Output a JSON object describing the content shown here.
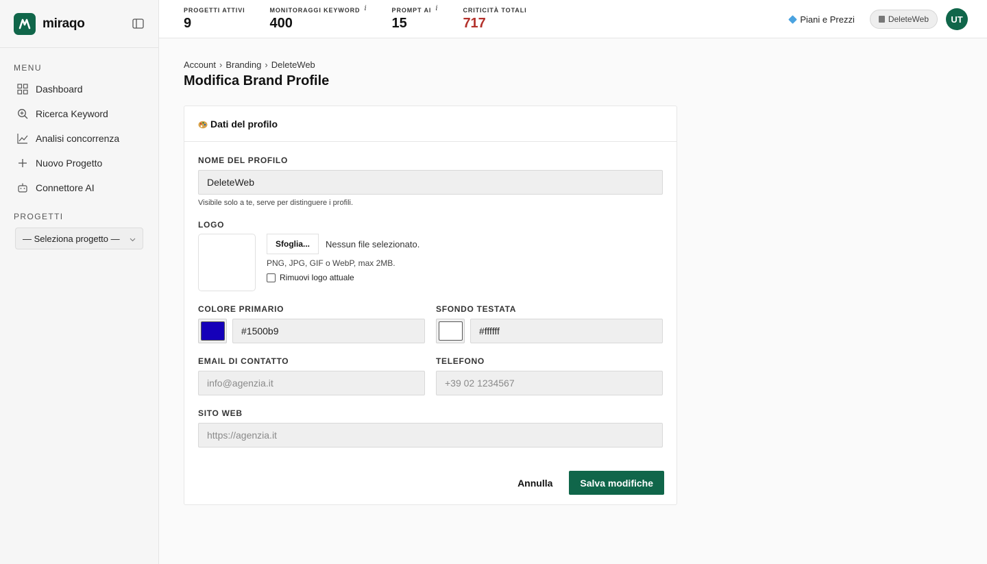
{
  "app": {
    "name": "miraqo",
    "accent": "#10664a"
  },
  "sidebar": {
    "menu_label": "MENU",
    "items": [
      {
        "label": "Dashboard",
        "icon": "grid-icon"
      },
      {
        "label": "Ricerca Keyword",
        "icon": "search-icon"
      },
      {
        "label": "Analisi concorrenza",
        "icon": "chart-line-icon"
      },
      {
        "label": "Nuovo Progetto",
        "icon": "plus-icon"
      },
      {
        "label": "Connettore AI",
        "icon": "robot-icon"
      }
    ],
    "projects_label": "PROGETTI",
    "project_select": "— Seleziona progetto —"
  },
  "topbar": {
    "stats": [
      {
        "label": "PROGETTI ATTIVI",
        "value": "9",
        "info": ""
      },
      {
        "label": "MONITORAGGI KEYWORD",
        "value": "400",
        "info": "i"
      },
      {
        "label": "PROMPT AI",
        "value": "15",
        "info": "i"
      },
      {
        "label": "CRITICITÀ TOTALI",
        "value": "717",
        "info": ""
      }
    ],
    "plans_label": "Piani e Prezzi",
    "workspace_label": "DeleteWeb",
    "avatar_initials": "UT"
  },
  "breadcrumb": [
    "Account",
    "Branding",
    "DeleteWeb"
  ],
  "page_title": "Modifica Brand Profile",
  "card": {
    "title": "Dati del profilo",
    "profile_name": {
      "label": "NOME DEL PROFILO",
      "value": "DeleteWeb",
      "hint": "Visibile solo a te, serve per distinguere i profili."
    },
    "logo": {
      "label": "LOGO",
      "browse_label": "Sfoglia...",
      "file_status": "Nessun file selezionato.",
      "formats": "PNG, JPG, GIF o WebP, max 2MB.",
      "remove_label": "Rimuovi logo attuale"
    },
    "primary_color": {
      "label": "COLORE PRIMARIO",
      "value": "#1500b9",
      "swatch": "#1500b9"
    },
    "header_bg": {
      "label": "SFONDO TESTATA",
      "value": "#ffffff",
      "swatch": "#ffffff"
    },
    "email": {
      "label": "EMAIL DI CONTATTO",
      "placeholder": "info@agenzia.it"
    },
    "phone": {
      "label": "TELEFONO",
      "placeholder": "+39 02 1234567"
    },
    "website": {
      "label": "SITO WEB",
      "placeholder": "https://agenzia.it"
    },
    "cancel_label": "Annulla",
    "save_label": "Salva modifiche"
  }
}
